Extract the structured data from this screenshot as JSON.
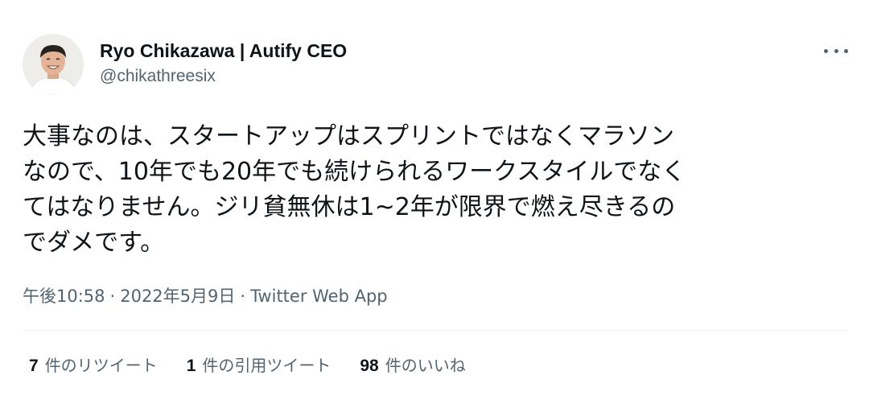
{
  "author": {
    "display_name": "Ryo Chikazawa | Autify CEO",
    "handle": "@chikathreesix",
    "avatar": "avatar-photo"
  },
  "more_icon": "more-horizontal-icon",
  "tweet": {
    "lines": [
      "大事なのは、スタートアップはスプリントではなくマラソン",
      "なので、10年でも20年でも続けられるワークスタイルでなく",
      "てはなりません。ジリ貧無休は1~2年が限界で燃え尽きるの",
      "でダメです。"
    ]
  },
  "meta": {
    "time": "午後10:58",
    "separator": "·",
    "date": "2022年5月9日",
    "source": "Twitter Web App"
  },
  "stats": [
    {
      "count": "7",
      "label": "件のリツイート"
    },
    {
      "count": "1",
      "label": "件の引用ツイート"
    },
    {
      "count": "98",
      "label": "件のいいね"
    }
  ],
  "colors": {
    "text": "#0f1419",
    "secondary": "#536471",
    "divider": "#eff3f4"
  }
}
